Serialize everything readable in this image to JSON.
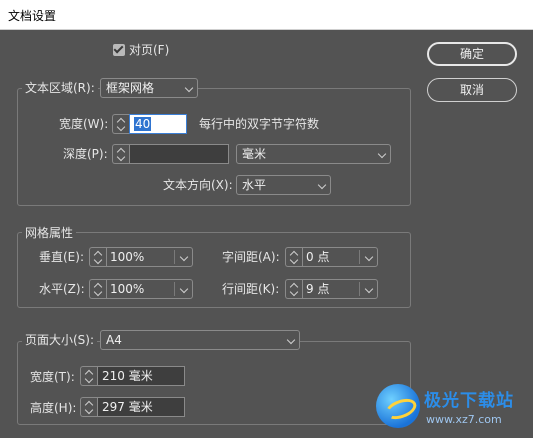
{
  "window": {
    "title": "文档设置"
  },
  "facing_pages": {
    "label": "对页(F)",
    "checked": true
  },
  "buttons": {
    "ok": "确定",
    "cancel": "取消"
  },
  "text_area": {
    "label": "文本区域(R):",
    "mode": "框架网格",
    "width_label": "宽度(W):",
    "width_value": "40",
    "width_hint": "每行中的双字节字符数",
    "depth_label": "深度(P):",
    "depth_value": "",
    "depth_unit": "毫米",
    "direction_label": "文本方向(X):",
    "direction_value": "水平"
  },
  "grid": {
    "title": "网格属性",
    "vertical_label": "垂直(E):",
    "vertical_value": "100%",
    "horizontal_label": "水平(Z):",
    "horizontal_value": "100%",
    "char_spacing_label": "字间距(A):",
    "char_spacing_value": "0 点",
    "line_spacing_label": "行间距(K):",
    "line_spacing_value": "9 点"
  },
  "page_size": {
    "label": "页面大小(S):",
    "value": "A4",
    "width_label": "宽度(T):",
    "width_value": "210 毫米",
    "height_label": "高度(H):",
    "height_value": "297 毫米"
  },
  "watermark": {
    "text": "极光下载站",
    "url": "www.xz7.com"
  }
}
